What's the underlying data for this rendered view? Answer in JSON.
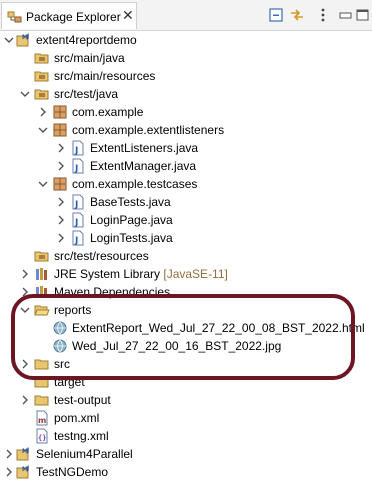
{
  "view": {
    "tab_label": "Package Explorer",
    "close_glyph": "✕"
  },
  "toolbar": {
    "icons": [
      "collapse-all-icon",
      "link-with-editor-icon",
      "view-menu-icon"
    ]
  },
  "tree": {
    "rows": [
      {
        "label": "extent4reportdemo",
        "extra": "",
        "expanded": true,
        "icon": "maven-project-icon"
      },
      {
        "label": "src/main/java",
        "extra": "",
        "expanded": null,
        "icon": "source-folder-icon"
      },
      {
        "label": "src/main/resources",
        "extra": "",
        "expanded": null,
        "icon": "source-folder-icon"
      },
      {
        "label": "src/test/java",
        "extra": "",
        "expanded": true,
        "icon": "source-folder-icon"
      },
      {
        "label": "com.example",
        "extra": "",
        "expanded": false,
        "icon": "package-icon"
      },
      {
        "label": "com.example.extentlisteners",
        "extra": "",
        "expanded": true,
        "icon": "package-icon"
      },
      {
        "label": "ExtentListeners.java",
        "extra": "",
        "expanded": false,
        "icon": "java-file-icon"
      },
      {
        "label": "ExtentManager.java",
        "extra": "",
        "expanded": false,
        "icon": "java-file-icon"
      },
      {
        "label": "com.example.testcases",
        "extra": "",
        "expanded": true,
        "icon": "package-icon"
      },
      {
        "label": "BaseTests.java",
        "extra": "",
        "expanded": false,
        "icon": "java-file-icon"
      },
      {
        "label": "LoginPage.java",
        "extra": "",
        "expanded": false,
        "icon": "java-file-icon"
      },
      {
        "label": "LoginTests.java",
        "extra": "",
        "expanded": false,
        "icon": "java-file-icon"
      },
      {
        "label": "src/test/resources",
        "extra": "",
        "expanded": null,
        "icon": "source-folder-icon"
      },
      {
        "label": "JRE System Library",
        "extra": "[JavaSE-11]",
        "expanded": false,
        "icon": "library-icon"
      },
      {
        "label": "Maven Dependencies",
        "extra": "",
        "expanded": false,
        "icon": "library-icon"
      },
      {
        "label": "reports",
        "extra": "",
        "expanded": true,
        "icon": "folder-icon"
      },
      {
        "label": "ExtentReport_Wed_Jul_27_22_00_08_BST_2022.html",
        "extra": "",
        "expanded": null,
        "icon": "web-file-icon"
      },
      {
        "label": "Wed_Jul_27_22_00_16_BST_2022.jpg",
        "extra": "",
        "expanded": null,
        "icon": "image-file-icon"
      },
      {
        "label": "src",
        "extra": "",
        "expanded": false,
        "icon": "folder-icon"
      },
      {
        "label": "target",
        "extra": "",
        "expanded": null,
        "icon": "folder-icon"
      },
      {
        "label": "test-output",
        "extra": "",
        "expanded": false,
        "icon": "folder-icon"
      },
      {
        "label": "pom.xml",
        "extra": "",
        "expanded": null,
        "icon": "maven-pom-icon"
      },
      {
        "label": "testng.xml",
        "extra": "",
        "expanded": null,
        "icon": "xml-file-icon"
      },
      {
        "label": "Selenium4Parallel",
        "extra": "",
        "expanded": false,
        "icon": "maven-project-icon"
      },
      {
        "label": "TestNGDemo",
        "extra": "",
        "expanded": false,
        "icon": "maven-project-icon"
      }
    ]
  },
  "colors": {
    "highlight_border": "#6e1523",
    "decoration_text": "#946c3c",
    "package_icon": "#9a6a3a",
    "folder_icon": "#e8c670"
  }
}
